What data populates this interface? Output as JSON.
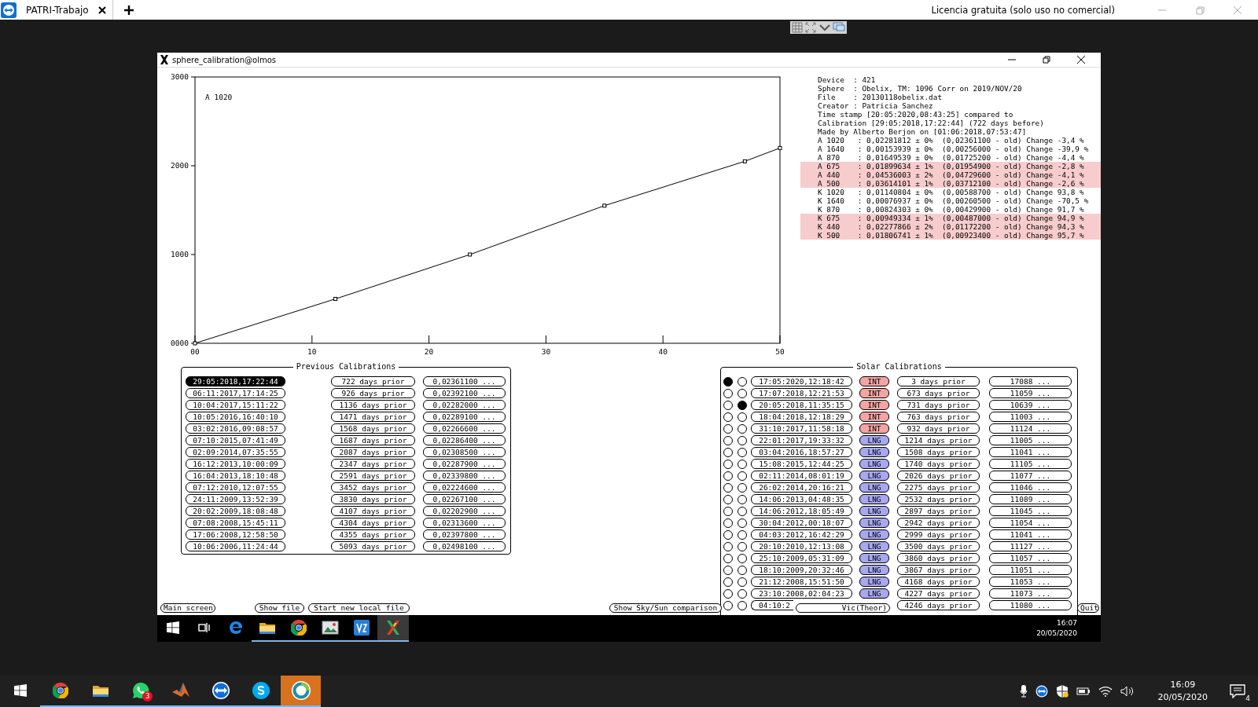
{
  "app_bar": {
    "tab": {
      "label": "PATRI-Trabajo",
      "selected": true
    },
    "license_notice": "Licencia gratuita (solo uso no comercial)"
  },
  "remote_window": {
    "title": "sphere_calibration@olmos"
  },
  "chart": {
    "chart_data": {
      "type": "line",
      "x": [
        0,
        12,
        23.5,
        35,
        47,
        50
      ],
      "series": [
        {
          "values": [
            0,
            500,
            1000,
            1550,
            2050,
            2200
          ],
          "marker": "square"
        }
      ],
      "xlim": [
        0,
        50
      ],
      "ylim": [
        0,
        3000
      ],
      "xticks": [
        {
          "value": 0,
          "label": "00"
        },
        {
          "value": 10,
          "label": "10"
        },
        {
          "value": 20,
          "label": "20"
        },
        {
          "value": 30,
          "label": "30"
        },
        {
          "value": 40,
          "label": "40"
        },
        {
          "value": 50,
          "label": "50"
        }
      ],
      "yticks": [
        {
          "value": 0,
          "label": "0000"
        },
        {
          "value": 1000,
          "label": "1000"
        },
        {
          "value": 2000,
          "label": "2000"
        },
        {
          "value": 3000,
          "label": "3000"
        }
      ],
      "annotations": [
        "A 1020"
      ]
    }
  },
  "info": {
    "lines": [
      {
        "text": "Device  : 421",
        "highlighted": false
      },
      {
        "text": "Sphere  : Obelix, TM: 1096 Corr on 2019/NOV/20",
        "highlighted": false
      },
      {
        "text": "File    : 20130118obelix.dat",
        "highlighted": false
      },
      {
        "text": "Creator : Patricia Sanchez",
        "highlighted": false
      },
      {
        "text": "Time stamp [20:05:2020,08:43:25] compared to",
        "highlighted": false
      },
      {
        "text": "Calibration [29:05:2018,17:22:44] (722 days before)",
        "highlighted": false
      },
      {
        "text": "Made by Alberto Berjon on [01:06:2018,07:53:47]",
        "highlighted": false
      },
      {
        "text": "A 1020   : 0,02281812 ± 0%  (0,02361100 - old) Change -3,4 %",
        "highlighted": false
      },
      {
        "text": "A 1640   : 0,00153939 ± 0%  (0,00256000 - old) Change -39,9 %",
        "highlighted": false
      },
      {
        "text": "A 870    : 0,01649539 ± 0%  (0,01725200 - old) Change -4,4 %",
        "highlighted": false
      },
      {
        "text": "A 675    : 0,01899634 ± 1%  (0,01954900 - old) Change -2,8 %",
        "highlighted": true
      },
      {
        "text": "A 440    : 0,04536003 ± 2%  (0,04729600 - old) Change -4,1 %",
        "highlighted": true
      },
      {
        "text": "A 500    : 0,03614101 ± 1%  (0,03712100 - old) Change -2,6 %",
        "highlighted": true
      },
      {
        "text": "K 1020   : 0,01140804 ± 0%  (0,00588700 - old) Change 93,8 %",
        "highlighted": false
      },
      {
        "text": "K 1640   : 0,00076937 ± 0%  (0,00260500 - old) Change -70,5 %",
        "highlighted": false
      },
      {
        "text": "K 870    : 0,00824303 ± 0%  (0,00429900 - old) Change 91,7 %",
        "highlighted": false
      },
      {
        "text": "K 675    : 0,00949334 ± 1%  (0,00487000 - old) Change 94,9 %",
        "highlighted": true
      },
      {
        "text": "K 440    : 0,02277866 ± 2%  (0,01172200 - old) Change 94,3 %",
        "highlighted": true
      },
      {
        "text": "K 500    : 0,01806741 ± 1%  (0,00923400 - old) Change 95,7 %",
        "highlighted": true
      }
    ]
  },
  "previous_calibrations": {
    "title": "Previous Calibrations",
    "rows": [
      {
        "date": "29:05:2018,17:22:44",
        "selected": true,
        "days": "722 days prior",
        "value": "0,02361100 ..."
      },
      {
        "date": "06:11:2017,17:14:25",
        "selected": false,
        "days": "926 days prior",
        "value": "0,02392100 ..."
      },
      {
        "date": "10:04:2017,15:11:22",
        "selected": false,
        "days": "1136 days prior",
        "value": "0,02282000 ..."
      },
      {
        "date": "10:05:2016,16:40:10",
        "selected": false,
        "days": "1471 days prior",
        "value": "0,02289100 ..."
      },
      {
        "date": "03:02:2016,09:08:57",
        "selected": false,
        "days": "1568 days prior",
        "value": "0,02266600 ..."
      },
      {
        "date": "07:10:2015,07:41:49",
        "selected": false,
        "days": "1687 days prior",
        "value": "0,02286400 ..."
      },
      {
        "date": "02:09:2014,07:35:55",
        "selected": false,
        "days": "2087 days prior",
        "value": "0,02308500 ..."
      },
      {
        "date": "16:12:2013,10:00:09",
        "selected": false,
        "days": "2347 days prior",
        "value": "0,02287900 ..."
      },
      {
        "date": "16:04:2013,18:10:48",
        "selected": false,
        "days": "2591 days prior",
        "value": "0,02339800 ..."
      },
      {
        "date": "07:12:2010,12:07:55",
        "selected": false,
        "days": "3452 days prior",
        "value": "0,02224600 ..."
      },
      {
        "date": "24:11:2009,13:52:39",
        "selected": false,
        "days": "3830 days prior",
        "value": "0,02267100 ..."
      },
      {
        "date": "20:02:2009,18:08:48",
        "selected": false,
        "days": "4107 days prior",
        "value": "0,02202900 ..."
      },
      {
        "date": "07:08:2008,15:45:11",
        "selected": false,
        "days": "4304 days prior",
        "value": "0,02313600 ..."
      },
      {
        "date": "17:06:2008,12:58:50",
        "selected": false,
        "days": "4355 days prior",
        "value": "0,02397800 ..."
      },
      {
        "date": "10:06:2006,11:24:44",
        "selected": false,
        "days": "5093 days prior",
        "value": "0,02498100 ..."
      }
    ]
  },
  "solar_calibrations": {
    "title": "Solar Calibrations",
    "rows": [
      {
        "first_selected": true,
        "second_selected": false,
        "date": "17:05:2020,12:18:42",
        "tag": {
          "label": "INT",
          "color": "#f4a4a4"
        },
        "days": "3 days prior",
        "value": "17088 ..."
      },
      {
        "first_selected": false,
        "second_selected": false,
        "date": "17:07:2018,12:21:53",
        "tag": {
          "label": "INT",
          "color": "#f4a4a4"
        },
        "days": "673 days prior",
        "value": "11059 ..."
      },
      {
        "first_selected": false,
        "second_selected": true,
        "date": "20:05:2018,11:35:15",
        "tag": {
          "label": "INT",
          "color": "#f4a4a4"
        },
        "days": "731 days prior",
        "value": "10639 ..."
      },
      {
        "first_selected": false,
        "second_selected": false,
        "date": "18:04:2018,12:18:29",
        "tag": {
          "label": "INT",
          "color": "#f4a4a4"
        },
        "days": "763 days prior",
        "value": "11003 ..."
      },
      {
        "first_selected": false,
        "second_selected": false,
        "date": "31:10:2017,11:58:18",
        "tag": {
          "label": "INT",
          "color": "#f4a4a4"
        },
        "days": "932 days prior",
        "value": "11124 ..."
      },
      {
        "first_selected": false,
        "second_selected": false,
        "date": "22:01:2017,19:33:32",
        "tag": {
          "label": "LNG",
          "color": "#a8a8f0"
        },
        "days": "1214 days prior",
        "value": "11005 ..."
      },
      {
        "first_selected": false,
        "second_selected": false,
        "date": "03:04:2016,18:57:27",
        "tag": {
          "label": "LNG",
          "color": "#a8a8f0"
        },
        "days": "1508 days prior",
        "value": "11041 ..."
      },
      {
        "first_selected": false,
        "second_selected": false,
        "date": "15:08:2015,12:44:25",
        "tag": {
          "label": "LNG",
          "color": "#a8a8f0"
        },
        "days": "1740 days prior",
        "value": "11105 ..."
      },
      {
        "first_selected": false,
        "second_selected": false,
        "date": "02:11:2014,08:01:19",
        "tag": {
          "label": "LNG",
          "color": "#a8a8f0"
        },
        "days": "2026 days prior",
        "value": "11077 ..."
      },
      {
        "first_selected": false,
        "second_selected": false,
        "date": "26:02:2014,20:16:21",
        "tag": {
          "label": "LNG",
          "color": "#a8a8f0"
        },
        "days": "2275 days prior",
        "value": "11046 ..."
      },
      {
        "first_selected": false,
        "second_selected": false,
        "date": "14:06:2013,04:48:35",
        "tag": {
          "label": "LNG",
          "color": "#a8a8f0"
        },
        "days": "2532 days prior",
        "value": "11089 ..."
      },
      {
        "first_selected": false,
        "second_selected": false,
        "date": "14:06:2012,18:05:49",
        "tag": {
          "label": "LNG",
          "color": "#a8a8f0"
        },
        "days": "2897 days prior",
        "value": "11045 ..."
      },
      {
        "first_selected": false,
        "second_selected": false,
        "date": "30:04:2012,00:18:07",
        "tag": {
          "label": "LNG",
          "color": "#a8a8f0"
        },
        "days": "2942 days prior",
        "value": "11054 ..."
      },
      {
        "first_selected": false,
        "second_selected": false,
        "date": "04:03:2012,16:42:29",
        "tag": {
          "label": "LNG",
          "color": "#a8a8f0"
        },
        "days": "2999 days prior",
        "value": "11041 ..."
      },
      {
        "first_selected": false,
        "second_selected": false,
        "date": "20:10:2010,12:13:08",
        "tag": {
          "label": "LNG",
          "color": "#a8a8f0"
        },
        "days": "3500 days prior",
        "value": "11127 ..."
      },
      {
        "first_selected": false,
        "second_selected": false,
        "date": "25:10:2009,05:31:09",
        "tag": {
          "label": "LNG",
          "color": "#a8a8f0"
        },
        "days": "3860 days prior",
        "value": "11057 ..."
      },
      {
        "first_selected": false,
        "second_selected": false,
        "date": "18:10:2009,20:32:46",
        "tag": {
          "label": "LNG",
          "color": "#a8a8f0"
        },
        "days": "3867 days prior",
        "value": "11051 ..."
      },
      {
        "first_selected": false,
        "second_selected": false,
        "date": "21:12:2008,15:51:50",
        "tag": {
          "label": "LNG",
          "color": "#a8a8f0"
        },
        "days": "4168 days prior",
        "value": "11053 ..."
      },
      {
        "first_selected": false,
        "second_selected": false,
        "date": "23:10:2008,02:04:23",
        "tag": {
          "label": "LNG",
          "color": "#a8a8f0"
        },
        "days": "4227 days prior",
        "value": "11073 ..."
      },
      {
        "first_selected": false,
        "second_selected": false,
        "date": "04:10:2",
        "days": "4246 days prior",
        "value": "11080 ..."
      }
    ]
  },
  "bottom_buttons": [
    {
      "label": "Main screen"
    },
    {
      "label": "Show file"
    },
    {
      "label": "Start new local file"
    },
    {
      "label": "Show Sky/Sun comparison"
    },
    {
      "label": "Vic(Theor)"
    },
    {
      "label": "Quit"
    }
  ],
  "remote_taskbar": {
    "apps": [
      {
        "kind": "windows",
        "open": false,
        "selected": false
      },
      {
        "kind": "taskview",
        "open": false,
        "selected": false
      },
      {
        "kind": "edge",
        "open": false,
        "selected": false
      },
      {
        "kind": "folder",
        "open": true,
        "selected": false
      },
      {
        "kind": "chrome",
        "open": true,
        "selected": false
      },
      {
        "kind": "image",
        "open": true,
        "selected": false
      },
      {
        "kind": "ve",
        "open": true,
        "selected": false
      },
      {
        "kind": "x",
        "open": true,
        "selected": true
      }
    ],
    "clock": {
      "time": "16:07",
      "date": "20/05/2020"
    }
  },
  "taskbar": {
    "apps": [
      {
        "kind": "windows",
        "open": false,
        "selected": false
      },
      {
        "kind": "chrome",
        "open": true,
        "selected": false
      },
      {
        "kind": "folder",
        "open": true,
        "selected": false
      },
      {
        "kind": "whatsapp",
        "open": true,
        "selected": false,
        "badge": "3"
      },
      {
        "kind": "matlab",
        "open": true,
        "selected": false
      },
      {
        "kind": "teamviewer",
        "open": true,
        "selected": false
      },
      {
        "kind": "skype",
        "open": true,
        "selected": false
      },
      {
        "kind": "app",
        "open": true,
        "selected": true
      }
    ],
    "clock": {
      "time": "16:09",
      "date": "20/05/2020"
    },
    "notification_count": "4"
  }
}
